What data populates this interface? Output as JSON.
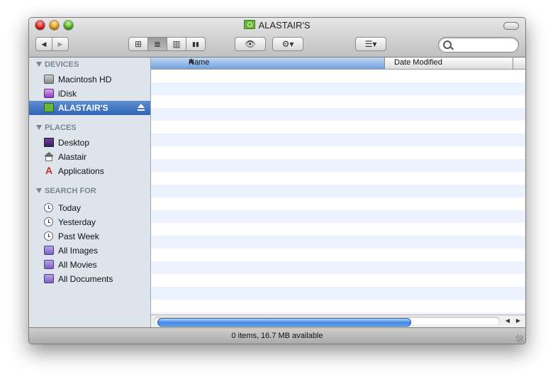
{
  "window": {
    "title": "ALASTAIR'S"
  },
  "toolbar": {
    "back_label": "◀",
    "forward_label": "▶",
    "view_icons": "⊞",
    "view_list": "≣",
    "view_columns": "▥",
    "view_coverflow": "▮▮",
    "quicklook_label": "👁",
    "action_label": "⚙▾",
    "arrange_label": "☰▾"
  },
  "search": {
    "value": "",
    "placeholder": ""
  },
  "sidebar": {
    "devices_header": "DEVICES",
    "devices": [
      {
        "label": "Macintosh HD",
        "icon": "hard-drive-icon"
      },
      {
        "label": "iDisk",
        "icon": "idisk-icon"
      },
      {
        "label": "ALASTAIR'S",
        "icon": "volume-icon",
        "selected": true
      }
    ],
    "places_header": "PLACES",
    "places": [
      {
        "label": "Desktop",
        "icon": "desktop-icon"
      },
      {
        "label": "Alastair",
        "icon": "home-icon"
      },
      {
        "label": "Applications",
        "icon": "applications-icon"
      }
    ],
    "search_header": "SEARCH FOR",
    "searches": [
      {
        "label": "Today",
        "icon": "clock-icon"
      },
      {
        "label": "Yesterday",
        "icon": "clock-icon"
      },
      {
        "label": "Past Week",
        "icon": "clock-icon"
      },
      {
        "label": "All Images",
        "icon": "smart-folder-icon"
      },
      {
        "label": "All Movies",
        "icon": "smart-folder-icon"
      },
      {
        "label": "All Documents",
        "icon": "smart-folder-icon"
      }
    ]
  },
  "columns": {
    "name": "Name",
    "date_modified": "Date Modified"
  },
  "status": {
    "text": "0 items, 16.7 MB available"
  },
  "colors": {
    "selection": "#2f64b6",
    "sidebar_bg": "#dde4ec",
    "row_stripe": "#edf3fe",
    "volume_green": "#6bb33a"
  }
}
